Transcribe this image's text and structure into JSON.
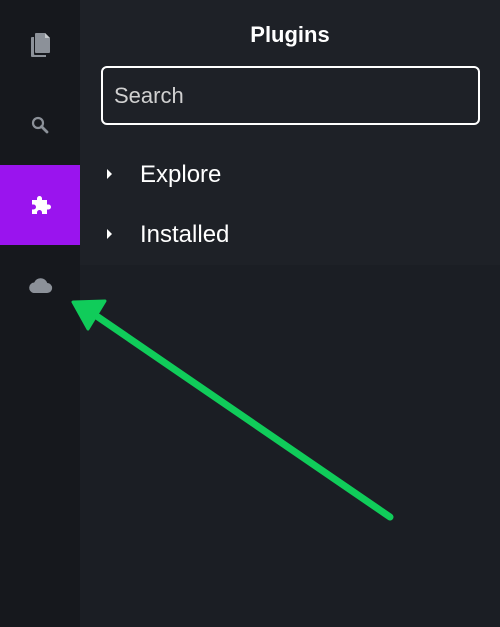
{
  "activity_bar": {
    "items": [
      {
        "icon": "files-icon",
        "active": false
      },
      {
        "icon": "search-icon",
        "active": false
      },
      {
        "icon": "puzzle-icon",
        "active": true
      },
      {
        "icon": "cloud-icon",
        "active": false
      }
    ],
    "active_color": "#9a14ee",
    "icon_color": "#8c9199"
  },
  "panel": {
    "title": "Plugins",
    "search": {
      "placeholder": "Search",
      "value": ""
    },
    "sections": [
      {
        "label": "Explore",
        "expanded": false
      },
      {
        "label": "Installed",
        "expanded": false
      }
    ]
  },
  "annotation": {
    "type": "arrow",
    "color": "#10cc5a",
    "points_to": "cloud-icon"
  }
}
